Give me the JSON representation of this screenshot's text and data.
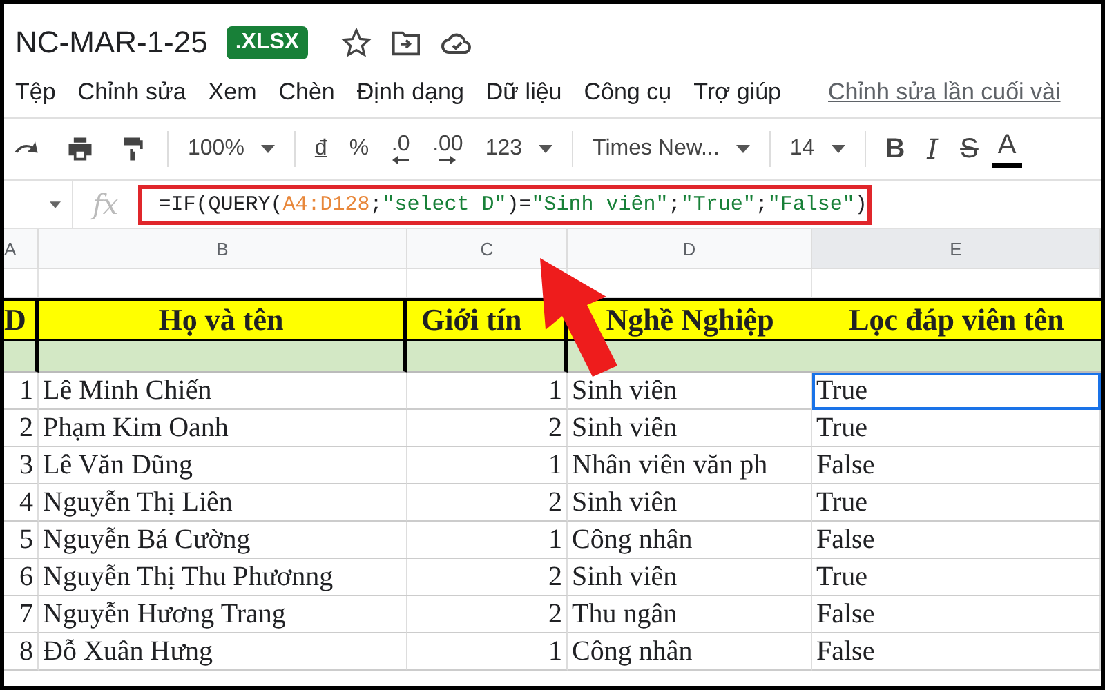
{
  "title": {
    "name": "NC-MAR-1-25",
    "badge": ".XLSX"
  },
  "menu": [
    "Tệp",
    "Chỉnh sửa",
    "Xem",
    "Chèn",
    "Định dạng",
    "Dữ liệu",
    "Công cụ",
    "Trợ giúp"
  ],
  "last_edit": "Chỉnh sửa lần cuối vài",
  "toolbar": [
    {
      "kind": "redo"
    },
    {
      "kind": "print"
    },
    {
      "kind": "paint"
    },
    {
      "kind": "sep"
    },
    {
      "kind": "dropdown",
      "label": "100%"
    },
    {
      "kind": "sep"
    },
    {
      "kind": "currency",
      "label": "đ"
    },
    {
      "kind": "text",
      "label": "%"
    },
    {
      "kind": "decimal_less",
      "label": ".0"
    },
    {
      "kind": "decimal_more",
      "label": ".00"
    },
    {
      "kind": "dropdown",
      "label": "123"
    },
    {
      "kind": "sep"
    },
    {
      "kind": "dropdown",
      "label": "Times New..."
    },
    {
      "kind": "sep"
    },
    {
      "kind": "dropdown",
      "label": "14"
    },
    {
      "kind": "sep"
    },
    {
      "kind": "bold",
      "label": "B"
    },
    {
      "kind": "italic",
      "label": "I"
    },
    {
      "kind": "strike",
      "label": "S"
    },
    {
      "kind": "color",
      "label": "A"
    }
  ],
  "formula_bar": {
    "fx_label": "fx",
    "tokens": [
      {
        "kind": "plain",
        "text": "=IF(QUERY("
      },
      {
        "kind": "range",
        "text": "A4:D128"
      },
      {
        "kind": "plain",
        "text": ";"
      },
      {
        "kind": "string",
        "text": "\"select D\""
      },
      {
        "kind": "plain",
        "text": ")="
      },
      {
        "kind": "string",
        "text": "\"Sinh viên\""
      },
      {
        "kind": "plain",
        "text": ";"
      },
      {
        "kind": "string",
        "text": "\"True\""
      },
      {
        "kind": "plain",
        "text": ";"
      },
      {
        "kind": "string",
        "text": "\"False\""
      },
      {
        "kind": "plain",
        "text": ")"
      }
    ]
  },
  "columns": [
    {
      "label": "A",
      "selected": false
    },
    {
      "label": "B",
      "selected": false
    },
    {
      "label": "C",
      "selected": false
    },
    {
      "label": "D",
      "selected": false
    },
    {
      "label": "E",
      "selected": true
    }
  ],
  "header": [
    "D",
    "Họ và tên",
    "Giới tín",
    "Nghề Nghiệp",
    "Lọc đáp viên tên"
  ],
  "rows": [
    {
      "cells": [
        "1",
        "Lê Minh Chiến",
        "1",
        "Sinh viên",
        "True"
      ],
      "selected": true
    },
    {
      "cells": [
        "2",
        "Phạm Kim Oanh",
        "2",
        "Sinh viên",
        "True"
      ],
      "selected": false
    },
    {
      "cells": [
        "3",
        "Lê Văn Dũng",
        "1",
        "Nhân viên văn ph",
        "False"
      ],
      "selected": false
    },
    {
      "cells": [
        "4",
        "Nguyễn Thị Liên",
        "2",
        "Sinh viên",
        "True"
      ],
      "selected": false
    },
    {
      "cells": [
        "5",
        "Nguyễn Bá Cường",
        "1",
        "Công nhân",
        "False"
      ],
      "selected": false
    },
    {
      "cells": [
        "6",
        "Nguyễn Thị Thu Phươnng",
        "2",
        "Sinh viên",
        "True"
      ],
      "selected": false
    },
    {
      "cells": [
        "7",
        "Nguyễn Hương Trang",
        "2",
        "Thu ngân",
        "False"
      ],
      "selected": false
    },
    {
      "cells": [
        "8",
        "Đỗ Xuân Hưng",
        "1",
        "Công nhân",
        "False"
      ],
      "selected": false
    }
  ]
}
